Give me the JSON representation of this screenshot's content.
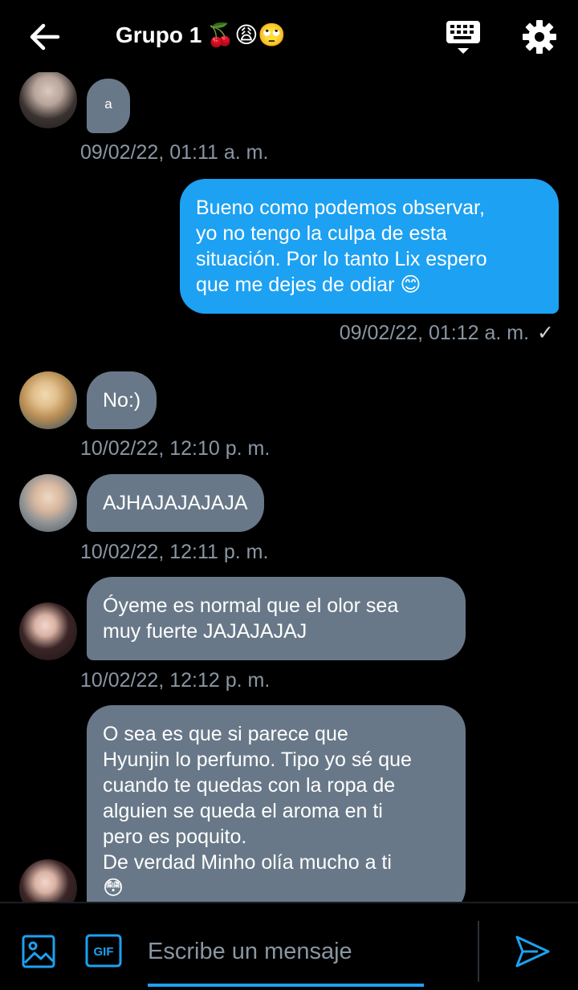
{
  "header": {
    "title": "Grupo 1",
    "title_emojis": "🍒😩🙄",
    "back_icon": "arrow-left-icon",
    "keyboard_icon": "keyboard-icon",
    "settings_icon": "gear-icon"
  },
  "messages": [
    {
      "direction": "in",
      "text": "a",
      "timestamp": "09/02/22, 01:11 a. m."
    },
    {
      "direction": "out",
      "text": "Bueno como podemos observar,\nyo no tengo la culpa de esta\nsituación. Por lo tanto Lix espero\nque me dejes de odiar 😊",
      "timestamp": "09/02/22, 01:12 a. m.",
      "status": "✓"
    },
    {
      "direction": "in",
      "text": "No:)",
      "timestamp": "10/02/22, 12:10 p. m."
    },
    {
      "direction": "in",
      "text": "AJHAJAJAJAJA",
      "timestamp": "10/02/22, 12:11 p. m."
    },
    {
      "direction": "in",
      "text": "Óyeme es normal que el olor sea\nmuy fuerte JAJAJAJAJ",
      "timestamp": "10/02/22, 12:12 p. m."
    },
    {
      "direction": "in",
      "text": "O sea es que si parece que\nHyunjin lo perfumo. Tipo yo sé que\ncuando te quedas con la ropa de\nalguien se queda el aroma en ti\npero es poquito.\nDe verdad Minho olía mucho a ti\n😳"
    }
  ],
  "composer": {
    "placeholder": "Escribe un mensaje",
    "image_icon": "image-icon",
    "gif_label": "GIF",
    "send_icon": "send-icon"
  },
  "colors": {
    "background": "#000000",
    "incoming_bubble": "#687888",
    "outgoing_bubble": "#1da1f2",
    "timestamp": "#8a96a3",
    "accent": "#1da1f2"
  }
}
